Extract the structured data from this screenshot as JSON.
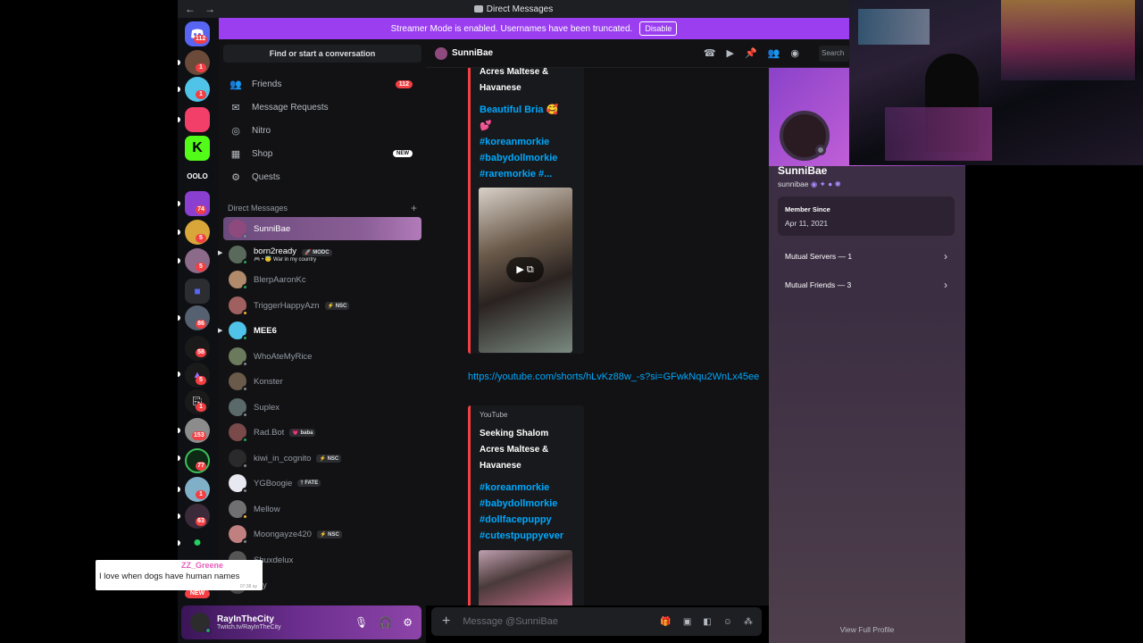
{
  "titlebar": {
    "back": "←",
    "forward": "→",
    "title": "Direct Messages"
  },
  "banner": {
    "text": "Streamer Mode is enabled. Usernames have been truncated.",
    "button": "Disable"
  },
  "rail": {
    "home_badge": "112",
    "badges": [
      "1",
      "1",
      "74",
      "5",
      "5",
      "86",
      "58",
      "5",
      "1",
      "153",
      "77",
      "1",
      "63",
      "NEW"
    ]
  },
  "sidebar": {
    "find": "Find or start a conversation",
    "nav": [
      {
        "label": "Friends",
        "icon": "friends-icon",
        "count": "112"
      },
      {
        "label": "Message Requests",
        "icon": "inbox-icon"
      },
      {
        "label": "Nitro",
        "icon": "nitro-icon"
      },
      {
        "label": "Shop",
        "icon": "shop-icon",
        "badge": "NEW"
      },
      {
        "label": "Quests",
        "icon": "quests-icon"
      }
    ],
    "dm_header": "Direct Messages",
    "dms": [
      {
        "name": "SunniBae"
      },
      {
        "name": "born2ready",
        "tag": "🚀 MODC",
        "sub": "🎮 • 😇 War in my country"
      },
      {
        "name": "BlerpAaronKc"
      },
      {
        "name": "TriggerHappyAzn",
        "tag": "⚡ NSC"
      },
      {
        "name": "MEE6"
      },
      {
        "name": "WhoAteMyRice"
      },
      {
        "name": "Konster"
      },
      {
        "name": "Suplex"
      },
      {
        "name": "Rad.Bot",
        "tag": "💗 baba"
      },
      {
        "name": "kiwi_in_cognito",
        "tag": "⚡ NSC"
      },
      {
        "name": "YGBoogie",
        "tag": "† FATE"
      },
      {
        "name": "Mellow"
      },
      {
        "name": "Moongayze420",
        "tag": "⚡ NSC"
      },
      {
        "name": "Shuxdelux"
      },
      {
        "name": "olfy"
      }
    ]
  },
  "user": {
    "name": "RayInTheCity",
    "status": "Twitch.tv/RayInTheCity"
  },
  "chat": {
    "recipient": "SunniBae",
    "search": "Search",
    "embed1": {
      "title_lines": [
        "Acres Maltese &",
        "Havanese"
      ],
      "desc_lines": [
        "Beautiful Bria 🥰",
        "💕",
        "#koreanmorkie",
        "#babydollmorkie",
        "#raremorkie #..."
      ]
    },
    "link": "https://youtube.com/shorts/hLvKz88w_-s?si=GFwkNqu2WnLx45ee",
    "embed2": {
      "provider": "YouTube",
      "title_lines": [
        "Seeking Shalom",
        "Acres Maltese &",
        "Havanese"
      ],
      "desc_lines": [
        "#koreanmorkie",
        "#babydollmorkie",
        "#dollfacepuppy",
        "#cutestpuppyever"
      ]
    },
    "composer_placeholder": "Message @SunniBae"
  },
  "profile": {
    "display_name": "SunniBae",
    "username": "sunnibae",
    "member_since_label": "Member Since",
    "member_since": "Apr 11, 2021",
    "mutual_servers": "Mutual Servers — 1",
    "mutual_friends": "Mutual Friends — 3",
    "view_full": "View Full Profile"
  },
  "overlay": {
    "user": "ZZ_Greene",
    "message": "I love when dogs have human names",
    "time": "07:38 ay"
  },
  "colors": {
    "accent": "#9a3ef0",
    "link": "#00a8fc",
    "danger": "#f23f43",
    "online": "#23a55a"
  }
}
